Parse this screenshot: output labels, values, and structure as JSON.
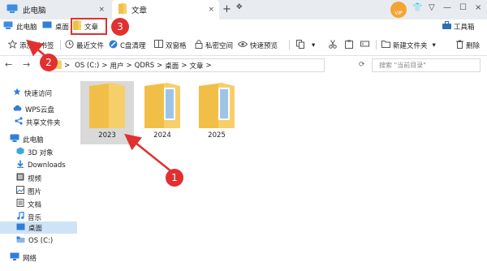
{
  "tabs": [
    {
      "label": "此电脑",
      "close": "×"
    },
    {
      "label": "文章",
      "close": "×"
    }
  ],
  "tab_actions": {
    "new_tab": "+",
    "menu": "✥"
  },
  "window": {
    "shirt": "👕",
    "pin": "▽",
    "minimize": "—",
    "maximize": "☐",
    "close": "×"
  },
  "avatar_text": "VIP",
  "bookmarks": [
    {
      "label": "此电脑"
    },
    {
      "label": "桌面"
    },
    {
      "label": "文章"
    }
  ],
  "toolbox_label": "工具箱",
  "toolbar": {
    "add_bookmark": "添加到书签",
    "recent_files": "最近文件",
    "disk_clean": "C盘清理",
    "dual_pane": "双窗格",
    "private_space": "私密空间",
    "quick_preview": "快速预览",
    "new_folder": "新建文件夹",
    "delete": "删除"
  },
  "address": {
    "crumbs": [
      "OS (C:)",
      "用户",
      "QDRS",
      "桌面",
      "文章"
    ],
    "separator": ">",
    "search_placeholder": "搜索 \"当前目录\""
  },
  "sidebar": [
    {
      "label": "快速访问",
      "icon": "star-icon",
      "color": "#2f7fd8"
    },
    {
      "label": "WPS云盘",
      "icon": "cloud-icon",
      "color": "#2f7fd8"
    },
    {
      "label": "共享文件夹",
      "icon": "share-icon",
      "color": "#2f7fd8"
    },
    {
      "label": "此电脑",
      "icon": "computer-icon",
      "color": "#2f7fd8"
    },
    {
      "label": "3D 对象",
      "icon": "cube-icon",
      "color": "#3aa6e0"
    },
    {
      "label": "Downloads",
      "icon": "download-icon",
      "color": "#2f7fd8"
    },
    {
      "label": "视频",
      "icon": "video-icon",
      "color": "#555555"
    },
    {
      "label": "图片",
      "icon": "picture-icon",
      "color": "#555555"
    },
    {
      "label": "文档",
      "icon": "document-icon",
      "color": "#555555"
    },
    {
      "label": "音乐",
      "icon": "music-icon",
      "color": "#2f7fd8"
    },
    {
      "label": "桌面",
      "icon": "desktop-icon",
      "color": "#2f7fd8"
    },
    {
      "label": "OS (C:)",
      "icon": "drive-icon",
      "color": "#2f7fd8"
    },
    {
      "label": "网络",
      "icon": "network-icon",
      "color": "#2f7fd8"
    }
  ],
  "folders": [
    {
      "label": "2023",
      "selected": true
    },
    {
      "label": "2024",
      "selected": false
    },
    {
      "label": "2025",
      "selected": false
    }
  ],
  "annotations": [
    "1",
    "2",
    "3"
  ],
  "colors": {
    "accent": "#2f7fd8",
    "annotation": "#e03030",
    "folder": "#f6cf6a",
    "selection": "#cfe3f8"
  }
}
